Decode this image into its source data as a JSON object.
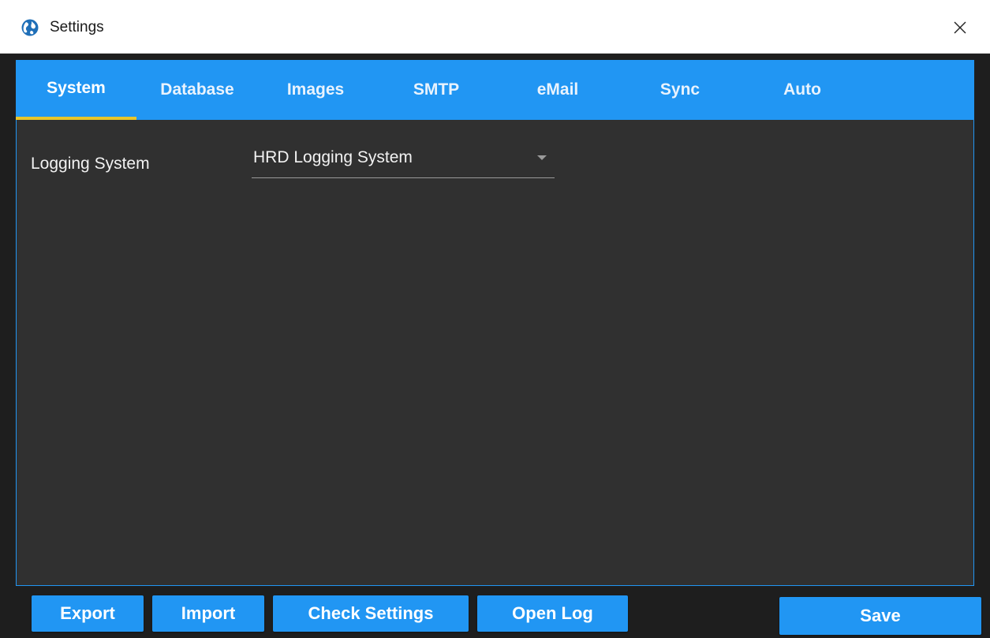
{
  "window": {
    "title": "Settings",
    "app_icon": "globe-icon",
    "close_icon": "close-icon"
  },
  "tabs": [
    {
      "label": "System",
      "active": true
    },
    {
      "label": "Database",
      "active": false
    },
    {
      "label": "Images",
      "active": false
    },
    {
      "label": "SMTP",
      "active": false
    },
    {
      "label": "eMail",
      "active": false
    },
    {
      "label": "Sync",
      "active": false
    },
    {
      "label": "Auto",
      "active": false
    }
  ],
  "system": {
    "logging_system_label": "Logging System",
    "logging_system_value": "HRD Logging System",
    "dropdown_icon": "chevron-down-icon"
  },
  "footer": {
    "export_label": "Export",
    "import_label": "Import",
    "check_settings_label": "Check Settings",
    "open_log_label": "Open Log",
    "save_label": "Save"
  },
  "colors": {
    "accent": "#2196f3",
    "active_tab_indicator": "#e8c62a",
    "panel_background": "#303030",
    "text": "#f2f2f2"
  }
}
